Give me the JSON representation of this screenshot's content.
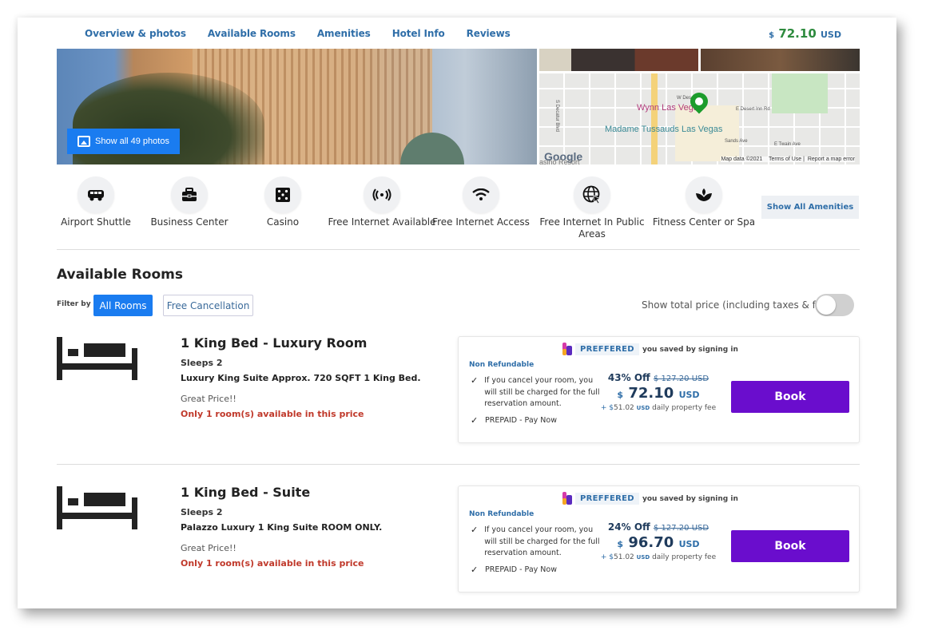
{
  "nav": {
    "tabs": [
      "Overview & photos",
      "Available Rooms",
      "Amenities",
      "Hotel Info",
      "Reviews"
    ],
    "price": {
      "currency_symbol": "$",
      "amount": "72.10",
      "currency": "USD"
    }
  },
  "gallery": {
    "show_photos_label": "Show all 49 photos",
    "map": {
      "labels": {
        "wynn": "Wynn Las Vegas",
        "madame": "Madame Tussauds Las Vegas",
        "w_desert": "W Desert Inn",
        "e_desert": "E Desert Inn Rd",
        "sands": "Sands Ave",
        "twain": "E Twain Ave",
        "decatur": "S Decatur Blvd",
        "casino": "asino Resort"
      },
      "brand": "Google",
      "footer": [
        "Map data ©2021",
        "Terms of Use",
        "Report a map error"
      ]
    }
  },
  "amenities": {
    "items": [
      {
        "label": "Airport Shuttle",
        "icon": "shuttle-icon"
      },
      {
        "label": "Business Center",
        "icon": "briefcase-icon"
      },
      {
        "label": "Casino",
        "icon": "dice-icon"
      },
      {
        "label": "Free Internet Available",
        "icon": "broadcast-icon"
      },
      {
        "label": "Free Internet Access",
        "icon": "wifi-icon"
      },
      {
        "label": "Free Internet In Public Areas",
        "icon": "globe-icon"
      },
      {
        "label": "Fitness Center or Spa",
        "icon": "lotus-icon"
      }
    ],
    "show_all_label": "Show All Amenities"
  },
  "rooms_section": {
    "title": "Available Rooms",
    "filter_label": "Filter by",
    "filters": [
      "All Rooms",
      "Free Cancellation"
    ],
    "active_filter": "All Rooms",
    "total_price_label": "Show total price (including taxes & fees)",
    "total_price_toggle": false
  },
  "rooms": [
    {
      "title": "1 King Bed - Luxury Room",
      "sleeps": "Sleeps 2",
      "description": "Luxury King Suite Approx. 720 SQFT 1 King Bed.",
      "great_price": "Great Price!!",
      "availability": "Only 1 room(s) available in this price",
      "offer": {
        "badge": "PREFFERED",
        "saved_text": "you saved by signing in",
        "refund_policy": "Non Refundable",
        "conditions": [
          "If you cancel your room, you will still be charged for the full reservation amount.",
          "PREPAID - Pay Now"
        ],
        "discount": "43% Off",
        "old_price_symbol": "$",
        "old_price": "127.20",
        "old_price_currency": "USD",
        "price_symbol": "$",
        "price": "72.10",
        "price_currency": "USD",
        "fee_prefix": "+ $",
        "fee_amount": "51.02",
        "fee_currency": "USD",
        "fee_suffix": "daily property fee",
        "book_label": "Book"
      }
    },
    {
      "title": "1 King Bed - Suite",
      "sleeps": "Sleeps 2",
      "description": "Palazzo Luxury 1 King Suite ROOM ONLY.",
      "great_price": "Great Price!!",
      "availability": "Only 1 room(s) available in this price",
      "offer": {
        "badge": "PREFFERED",
        "saved_text": "you saved by signing in",
        "refund_policy": "Non Refundable",
        "conditions": [
          "If you cancel your room, you will still be charged for the full reservation amount.",
          "PREPAID - Pay Now"
        ],
        "discount": "24% Off",
        "old_price_symbol": "$",
        "old_price": "127.20",
        "old_price_currency": "USD",
        "price_symbol": "$",
        "price": "96.70",
        "price_currency": "USD",
        "fee_prefix": "+ $",
        "fee_amount": "51.02",
        "fee_currency": "USD",
        "fee_suffix": "daily property fee",
        "book_label": "Book"
      }
    }
  ],
  "colors": {
    "nav_link": "#2f6ea8",
    "top_price": "#2e8b3e",
    "primary_button": "#1a7cf0",
    "book_button": "#6a0dcd",
    "availability_warning": "#c0392b",
    "map_pin": "#1c9c2c"
  }
}
